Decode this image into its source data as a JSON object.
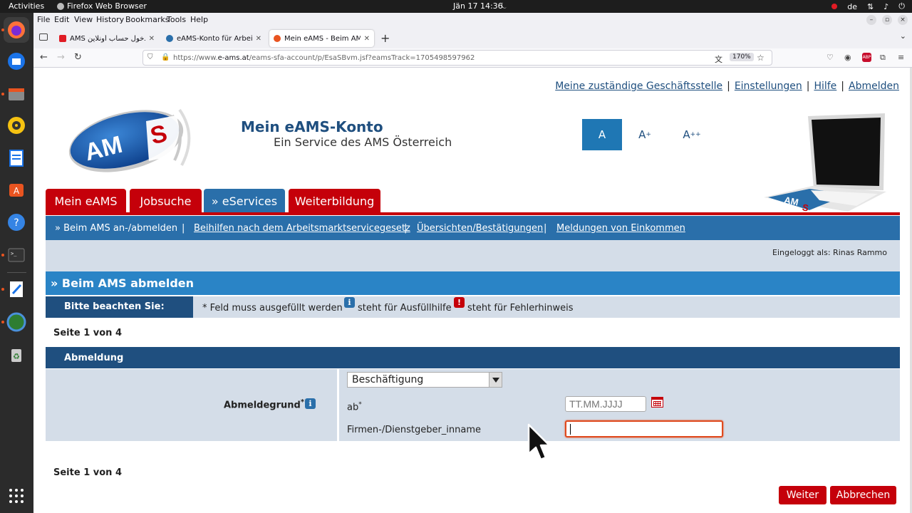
{
  "system": {
    "activities": "Activities",
    "app_name": "Firefox Web Browser",
    "clock": "Jän 17  14:36",
    "keyboard_layout": "de"
  },
  "browser": {
    "menu": [
      "File",
      "Edit",
      "View",
      "History",
      "Bookmarks",
      "Tools",
      "Help"
    ],
    "tabs": [
      {
        "title": "AMS الدخول حساب أونلاين",
        "favicon_color": "#e01b24"
      },
      {
        "title": "eAMS-Konto für Arbeitsu",
        "favicon_color": "#2a6faa"
      },
      {
        "title": "Mein eAMS - Beim AMS a",
        "favicon_color": "#e95420",
        "active": true
      }
    ],
    "url_prefix": "https://www.",
    "url_domain": "e-ams.at",
    "url_rest": "/eams-sfa-account/p/EsaSBvm.jsf?eamsTrack=1705498597962",
    "zoom": "170%"
  },
  "site": {
    "top_links": [
      "Meine zuständige Geschäftsstelle",
      "Einstellungen",
      "Hilfe",
      "Abmelden"
    ],
    "logo_text": "AMS",
    "title": "Mein eAMS-Konto",
    "subtitle": "Ein Service des AMS Österreich",
    "font_sizes": {
      "normal": "A",
      "large": "A",
      "large_sup": "+",
      "xlarge": "A",
      "xlarge_sup": "++"
    },
    "main_tabs": [
      "Mein eAMS",
      "Jobsuche",
      "» eServices",
      "Weiterbildung"
    ],
    "sub_nav": {
      "current": "» Beim AMS an-/abmelden",
      "links": [
        "Beihilfen nach dem Arbeitsmarktservicegesetz",
        "Übersichten/Bestätigungen",
        "Meldungen von Einkommen"
      ],
      "separator": "|"
    },
    "logged_in_as": "Eingeloggt als: Rinas Rammo",
    "page_heading": "» Beim AMS abmelden",
    "notice": {
      "label": "Bitte beachten Sie:",
      "required": "* Feld muss ausgefüllt werden",
      "info_text": "steht für Ausfüllhilfe",
      "error_text": "steht für Fehlerhinweis",
      "info_icon": "i",
      "error_icon": "!"
    },
    "page_indicator": "Seite 1 von 4",
    "form": {
      "section_title": "Abmeldung",
      "reason_label": "Abmeldegrund",
      "required_mark": "*",
      "reason_value": "Beschäftigung",
      "date_label": "ab",
      "date_placeholder": "TT.MM.JJJJ",
      "company_label": "Firmen-/Dienstgeber_inname",
      "company_value": ""
    },
    "buttons": {
      "next": "Weiter",
      "cancel": "Abbrechen"
    }
  },
  "colors": {
    "ams_red": "#c5000a",
    "ams_blue": "#2a6faa",
    "ams_dark_blue": "#1f4f7f",
    "light_panel": "#d4dde8",
    "focus_orange": "#e04a1e"
  }
}
